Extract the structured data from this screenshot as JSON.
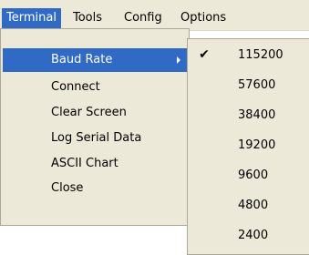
{
  "menubar": {
    "items": [
      {
        "label": "Terminal"
      },
      {
        "label": "Tools"
      },
      {
        "label": "Config"
      },
      {
        "label": "Options"
      }
    ]
  },
  "terminal_menu": {
    "items": [
      {
        "label": "Baud Rate"
      },
      {
        "label": "Connect"
      },
      {
        "label": "Clear Screen"
      },
      {
        "label": "Log Serial Data"
      },
      {
        "label": "ASCII Chart"
      },
      {
        "label": "Close"
      }
    ]
  },
  "baud_rate_menu": {
    "check_glyph": "✔",
    "selected": "115200",
    "items": [
      {
        "label": "115200"
      },
      {
        "label": "57600"
      },
      {
        "label": "38400"
      },
      {
        "label": "19200"
      },
      {
        "label": "9600"
      },
      {
        "label": "4800"
      },
      {
        "label": "2400"
      }
    ]
  },
  "icons": {
    "submenu_arrow": "triangle-right-icon",
    "check": "checkmark-icon"
  },
  "colors": {
    "menu_background": "#ece9d8",
    "highlight": "#316ac5",
    "border": "#aca899"
  }
}
